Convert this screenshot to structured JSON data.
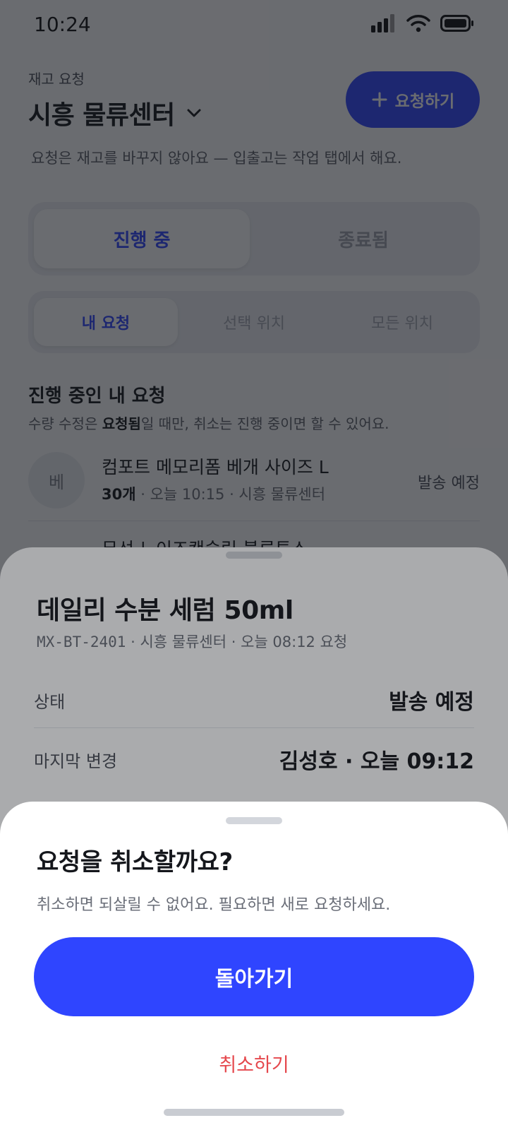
{
  "status_bar": {
    "time": "10:24"
  },
  "header": {
    "caption": "재고 요청",
    "title": "시흥 물류센터",
    "new_request_label": "요청하기",
    "note": "요청은 재고를 바꾸지 않아요 — 입출고는 작업 탭에서 해요."
  },
  "tabs": {
    "active": "진행 중",
    "inactive": "종료됨"
  },
  "scope": {
    "mine": "내 요청",
    "selected": "선택 위치",
    "all": "모든 위치"
  },
  "section": {
    "title": "진행 중인 내 요청",
    "note_bold": "요청됨",
    "note_prefix": "수량 수정은 ",
    "note_suffix": "일 때만, 취소는 진행 중이면 할 수 있어요."
  },
  "requests": [
    {
      "avatar": "베",
      "name": "컴포트 메모리폼 베개 사이즈 L",
      "qty": "30개",
      "meta": " · 오늘 10:15 · 시흥 물류센터",
      "status": "발송 예정"
    },
    {
      "name": "무선 노이즈캔슬링 블루투스"
    }
  ],
  "detail": {
    "title": "데일리 수분 세럼 50ml",
    "sku": "MX-BT-2401",
    "meta": " · 시흥 물류센터 · 오늘 08:12 요청",
    "rows": [
      {
        "label": "상태",
        "value": "발송 예정"
      },
      {
        "label": "마지막 변경",
        "value": "김성호 · 오늘 09:12"
      }
    ]
  },
  "confirm": {
    "title": "요청을 취소할까요?",
    "description": "취소하면 되살릴 수 없어요. 필요하면 새로 요청하세요.",
    "primary_label": "돌아가기",
    "destructive_label": "취소하기"
  },
  "colors": {
    "accent": "#2f45ff",
    "danger": "#e5484d"
  }
}
